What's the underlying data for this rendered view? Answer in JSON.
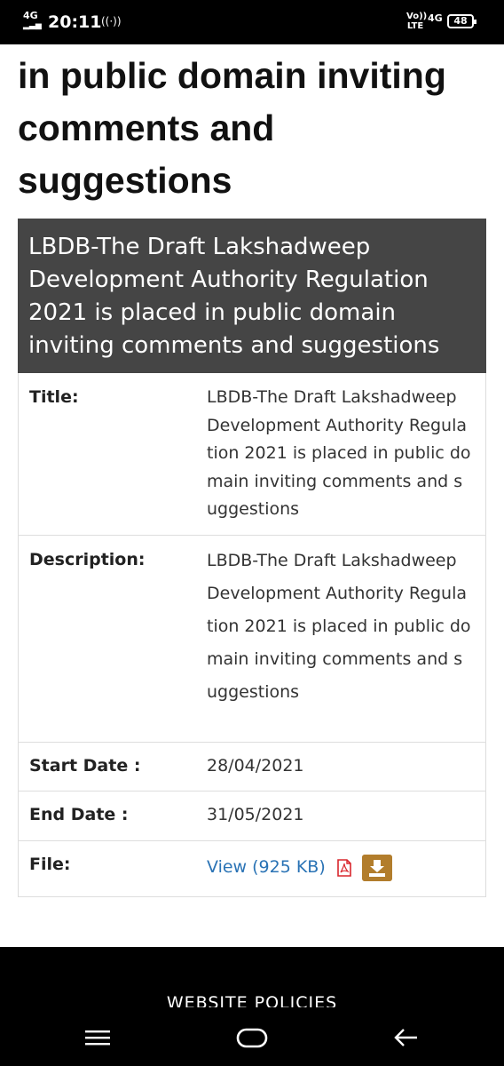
{
  "status_bar": {
    "network": "4G",
    "time": "20:11",
    "hotspot_icon": "hotspot-icon",
    "volte": "Vo)) LTE",
    "data_type": "4G",
    "battery": "48"
  },
  "page": {
    "heading": "in public domain inviting comments and suggestions"
  },
  "notice": {
    "header": "LBDB-The Draft Lakshadweep Development Authority Regulation 2021 is placed in public domain inviting comments and suggestions",
    "title_label": "Title:",
    "title_value": "LBDB-The Draft Lakshadweep Development Authority Regulation 2021 is placed in public domain inviting comments and suggestions",
    "description_label": "Description:",
    "description_value": "LBDB-The Draft Lakshadweep Development Authority Regulation 2021 is placed in public domain inviting comments and suggestions",
    "start_label": "Start Date :",
    "start_value": "28/04/2021",
    "end_label": "End Date :",
    "end_value": "31/05/2021",
    "file_label": "File:",
    "file_link": "View (925 KB)",
    "file_icon": "pdf-icon",
    "download_icon": "download-icon"
  },
  "footer": {
    "policies": "WEBSITE POLICIES"
  },
  "nav_bar": {
    "menu_icon": "menu-icon",
    "home_icon": "home-icon",
    "back_icon": "back-icon"
  },
  "colors": {
    "header_bg": "#454545",
    "link": "#2a73b5",
    "pdf_red": "#d9262c",
    "download_bg": "#b27d2c"
  }
}
